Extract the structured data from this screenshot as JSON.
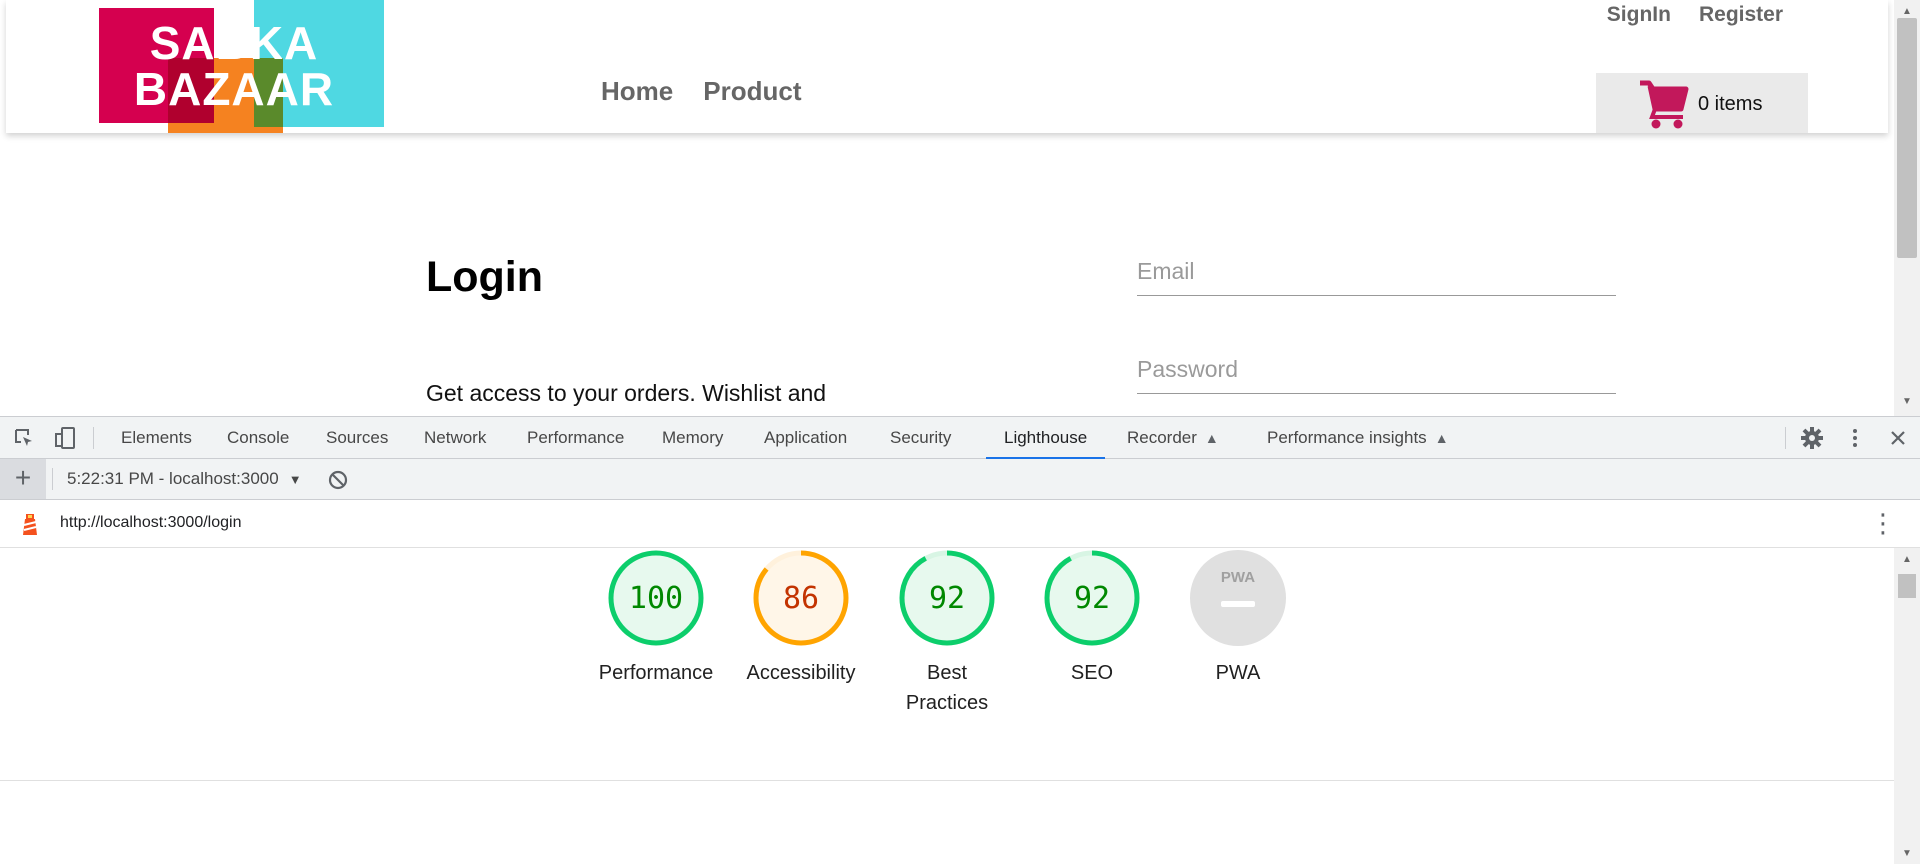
{
  "site": {
    "logo_text": "SABKA BAZAAR",
    "nav": {
      "home": "Home",
      "product": "Product"
    },
    "auth": {
      "signin": "SignIn",
      "register": "Register"
    },
    "cart": {
      "label": "0 items"
    },
    "login": {
      "title": "Login",
      "description": "Get access to your orders. Wishlist and Recommendations",
      "email_placeholder": "Email",
      "password_placeholder": "Password"
    },
    "colors": {
      "brand_pink": "#d5004f",
      "brand_orange": "#f58220",
      "brand_cyan": "#4fd8e2",
      "cart_icon": "#c2185b"
    }
  },
  "devtools": {
    "tabs": [
      "Elements",
      "Console",
      "Sources",
      "Network",
      "Performance",
      "Memory",
      "Application",
      "Security",
      "Lighthouse",
      "Recorder",
      "Performance insights"
    ],
    "active_tab": "Lighthouse",
    "toolbar": {
      "report_selector": "5:22:31 PM - localhost:3000"
    },
    "report_url": "http://localhost:3000/login",
    "scores": [
      {
        "label": "Performance",
        "score": "100",
        "status": "pass"
      },
      {
        "label": "Accessibility",
        "score": "86",
        "status": "average"
      },
      {
        "label": "Best Practices",
        "score": "92",
        "status": "pass"
      },
      {
        "label": "SEO",
        "score": "92",
        "status": "pass"
      },
      {
        "label": "PWA",
        "score": "PWA",
        "status": "na"
      }
    ],
    "colors": {
      "pass": "#0cce6b",
      "pass_text": "#008800",
      "average": "#ffa400",
      "average_text": "#c33300",
      "na": "#e0e0e0",
      "active_tab_underline": "#1a73e8"
    }
  }
}
